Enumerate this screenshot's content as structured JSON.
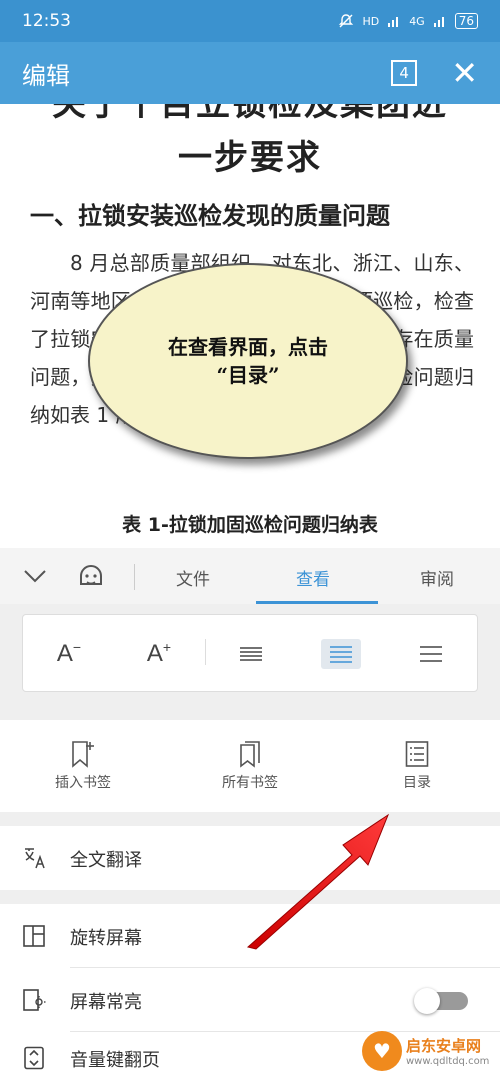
{
  "status": {
    "time": "12:53",
    "net1": "HD",
    "net2": "4G",
    "net3": "4G",
    "battery": "76"
  },
  "header": {
    "title": "编辑",
    "page_count": "4",
    "close": "✕"
  },
  "document": {
    "title_top": "关于个目立锁检及集团进",
    "title": "一步要求",
    "heading": "一、拉锁安装巡检发现的质量问题",
    "paragraph": "8 月总部质量部组织，对东北、浙江、山东、河南等地区的拉锁安装质量开展了专项巡检，检查了拉锁安装质量现场情况及查看现场是否存在质量问题，并提出标准进改进措施的要求，巡检问题归纳如表 1 所示：",
    "caption": "表 1-拉锁加固巡检问题归纳表"
  },
  "callout": {
    "line1": "在查看界面，点击",
    "line2": "“目录”"
  },
  "tabs": {
    "file": "文件",
    "view": "查看",
    "review": "审阅"
  },
  "format": {
    "font_decrease": "A",
    "font_increase": "A"
  },
  "bookmarks": {
    "insert": "插入书签",
    "all": "所有书签",
    "toc": "目录"
  },
  "list": {
    "translate": "全文翻译",
    "rotate": "旋转屏幕",
    "keep_on": "屏幕常亮",
    "volume": "音量键翻页"
  },
  "watermark": {
    "name": "启东安卓网",
    "url": "www.qdltdq.com"
  },
  "colors": {
    "primary": "#4a9fd8",
    "accent": "#3c93d6",
    "arrow": "#e02020",
    "callout": "#f7f3c9"
  }
}
